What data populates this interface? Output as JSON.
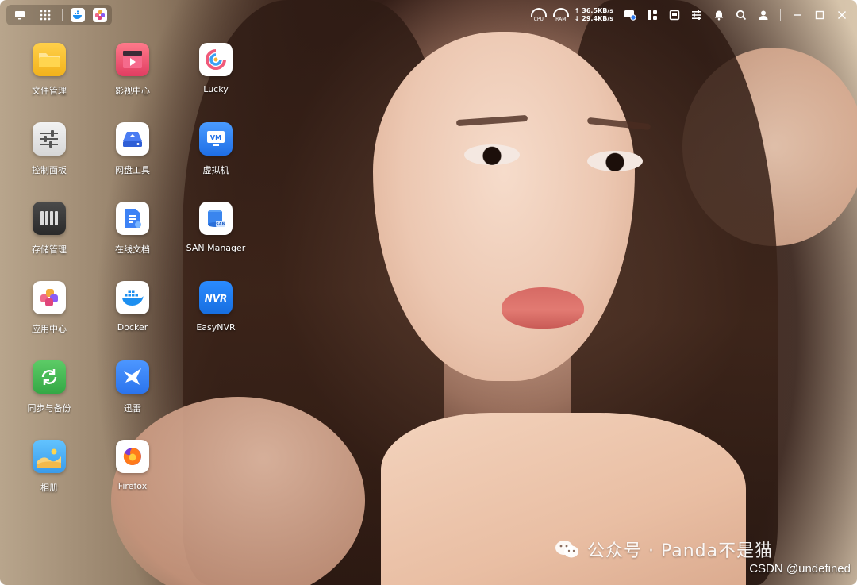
{
  "topbar": {
    "left": {
      "icons": [
        "desktop-icon",
        "grid-icon",
        "docker-mini-icon",
        "app-center-mini-icon"
      ]
    },
    "right": {
      "cpu_label": "CPU",
      "ram_label": "RAM",
      "upload_speed": "↑ 36.5KB/s",
      "download_speed": "↓ 29.4KB/s",
      "icons": [
        "user-status-icon",
        "widget-icon",
        "monitor-icon",
        "settings-sliders-icon",
        "bell-icon",
        "search-icon",
        "user-icon",
        "minimize-icon",
        "maximize-icon",
        "close-icon"
      ]
    }
  },
  "apps": [
    {
      "label": "文件管理",
      "icon": "folder-icon",
      "color": "#f6c232"
    },
    {
      "label": "影视中心",
      "icon": "video-icon",
      "color": "#e9456a"
    },
    {
      "label": "Lucky",
      "icon": "lucky-icon",
      "color": "#ffffff"
    },
    {
      "label": "控制面板",
      "icon": "control-panel-icon",
      "color": "#e6e6e6"
    },
    {
      "label": "网盘工具",
      "icon": "cloud-disk-icon",
      "color": "#ffffff"
    },
    {
      "label": "虚拟机",
      "icon": "vm-icon",
      "color": "#2f7bf0"
    },
    {
      "label": "存储管理",
      "icon": "storage-icon",
      "color": "#3b3b3b"
    },
    {
      "label": "在线文档",
      "icon": "document-icon",
      "color": "#ffffff"
    },
    {
      "label": "SAN Manager",
      "icon": "san-icon",
      "color": "#ffffff"
    },
    {
      "label": "应用中心",
      "icon": "app-center-icon",
      "color": "#ffffff"
    },
    {
      "label": "Docker",
      "icon": "docker-icon",
      "color": "#ffffff"
    },
    {
      "label": "EasyNVR",
      "icon": "easynvr-icon",
      "color": "#1f7cf2"
    },
    {
      "label": "同步与备份",
      "icon": "sync-icon",
      "color": "#3dbb4d"
    },
    {
      "label": "迅雷",
      "icon": "thunder-icon",
      "color": "#3a86f6"
    },
    {
      "label": "相册",
      "icon": "photo-icon",
      "color": "#4ab3f4"
    },
    {
      "label": "Firefox",
      "icon": "firefox-icon",
      "color": "#ffffff"
    }
  ],
  "watermark": {
    "text": "公众号 · Panda不是猫",
    "csdn": "CSDN @undefined"
  }
}
